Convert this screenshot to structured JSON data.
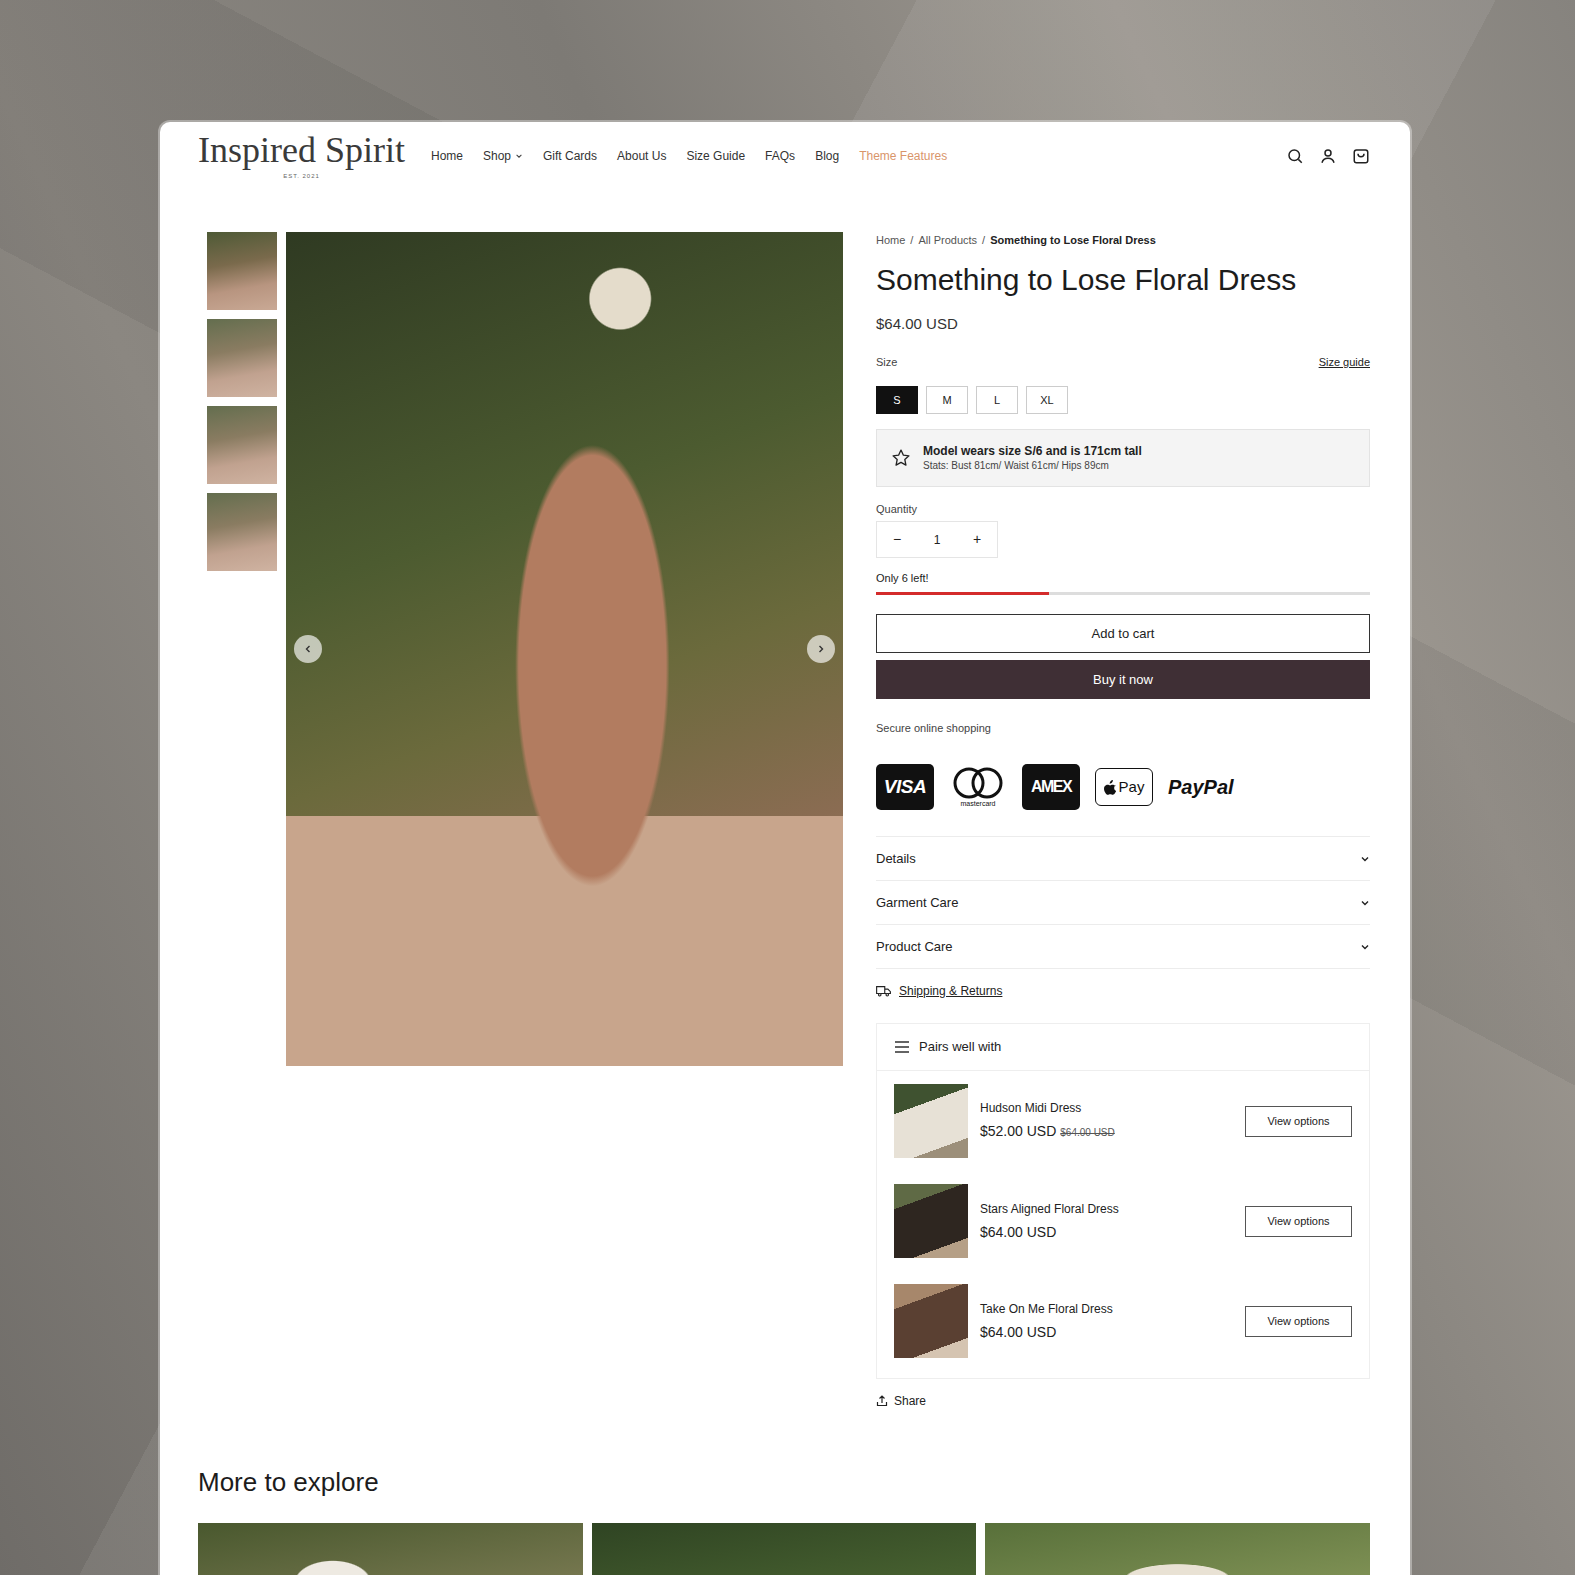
{
  "brand": {
    "name": "Inspired Spirit",
    "established": "EST. 2021"
  },
  "nav": [
    {
      "label": "Home",
      "dropdown": false,
      "highlight": false
    },
    {
      "label": "Shop",
      "dropdown": true,
      "highlight": false
    },
    {
      "label": "Gift Cards",
      "dropdown": false,
      "highlight": false
    },
    {
      "label": "About Us",
      "dropdown": false,
      "highlight": false
    },
    {
      "label": "Size Guide",
      "dropdown": false,
      "highlight": false
    },
    {
      "label": "FAQs",
      "dropdown": false,
      "highlight": false
    },
    {
      "label": "Blog",
      "dropdown": false,
      "highlight": false
    },
    {
      "label": "Theme Features",
      "dropdown": false,
      "highlight": true
    }
  ],
  "gallery": {
    "thumbnails": [
      {
        "selected": true
      },
      {
        "selected": false
      },
      {
        "selected": false
      },
      {
        "selected": false
      }
    ]
  },
  "breadcrumb": {
    "separator": "/",
    "items": [
      {
        "label": "Home",
        "current": false
      },
      {
        "label": "All Products",
        "current": false
      },
      {
        "label": "Something to Lose Floral Dress",
        "current": true
      }
    ]
  },
  "product": {
    "title": "Something to Lose Floral Dress",
    "price": "$64.00 USD"
  },
  "size": {
    "label": "Size",
    "guide": "Size guide",
    "options": [
      {
        "label": "S",
        "selected": true
      },
      {
        "label": "M",
        "selected": false
      },
      {
        "label": "L",
        "selected": false
      },
      {
        "label": "XL",
        "selected": false
      }
    ]
  },
  "model_note": {
    "title": "Model wears size S/6 and is 171cm tall",
    "stats": "Stats: Bust 81cm/ Waist 61cm/ Hips 89cm"
  },
  "quantity": {
    "label": "Quantity",
    "value": "1",
    "minus": "−",
    "plus": "+"
  },
  "stock": {
    "text": "Only 6 left!",
    "level": 0.35
  },
  "buttons": {
    "add": "Add to cart",
    "buy": "Buy it now"
  },
  "payments": {
    "title": "Secure online shopping",
    "methods": [
      {
        "label": "VISA",
        "kind": "visa"
      },
      {
        "label": "mastercard",
        "kind": "mastercard"
      },
      {
        "label": "AMEX",
        "kind": "amex"
      },
      {
        "label": "Pay",
        "kind": "applepay"
      },
      {
        "label": "PayPal",
        "kind": "paypal"
      }
    ]
  },
  "accordion": [
    {
      "label": "Details",
      "expanded": false
    },
    {
      "label": "Garment Care",
      "expanded": false
    },
    {
      "label": "Product Care",
      "expanded": false
    }
  ],
  "shipping": "Shipping & Returns",
  "pairs": {
    "title": "Pairs well with",
    "items": [
      {
        "name": "Hudson Midi Dress",
        "price": "$52.00 USD",
        "compare_price": "$64.00 USD",
        "button": "View options"
      },
      {
        "name": "Stars Aligned Floral Dress",
        "price": "$64.00 USD",
        "button": "View options"
      },
      {
        "name": "Take On Me Floral Dress",
        "price": "$64.00 USD",
        "button": "View options"
      }
    ]
  },
  "share": "Share",
  "more": {
    "title": "More to explore",
    "card_count": 3
  }
}
